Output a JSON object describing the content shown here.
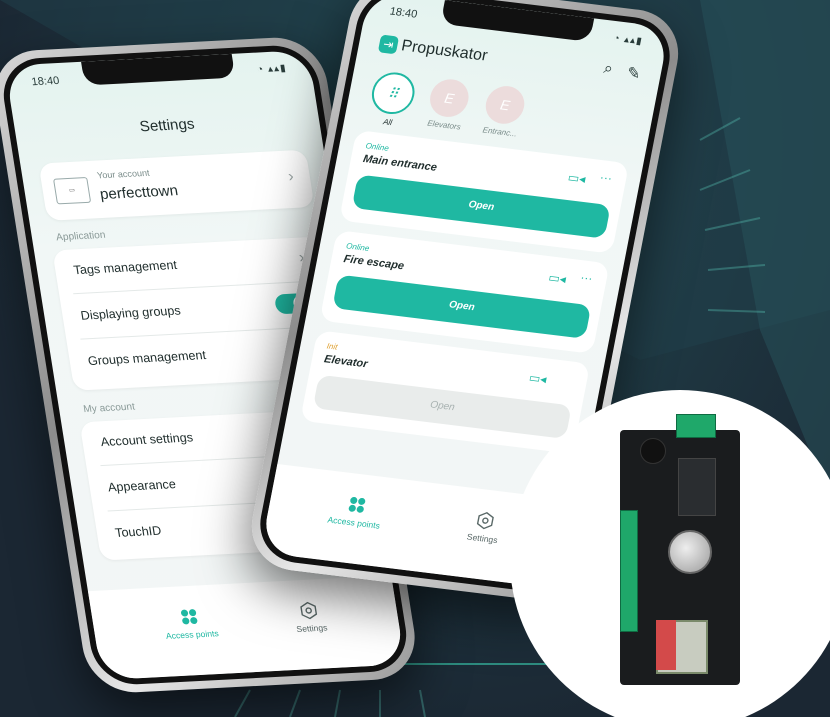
{
  "left_phone": {
    "status_time": "18:40",
    "title": "Settings",
    "account": {
      "label": "Your account",
      "name": "perfecttown"
    },
    "section_application": "Application",
    "rows_application": [
      {
        "label": "Tags management"
      },
      {
        "label": "Displaying groups"
      },
      {
        "label": "Groups management"
      }
    ],
    "section_my_account": "My account",
    "rows_account": [
      {
        "label": "Account settings"
      },
      {
        "label": "Appearance"
      },
      {
        "label": "TouchID"
      }
    ],
    "tabs": [
      {
        "label": "Access points"
      },
      {
        "label": "Settings"
      }
    ]
  },
  "right_phone": {
    "status_time": "18:40",
    "brand": "Propuskator",
    "groups": [
      {
        "label": "All",
        "glyph": "⠿"
      },
      {
        "label": "Elevators",
        "glyph": "E"
      },
      {
        "label": "Entranc...",
        "glyph": "E"
      }
    ],
    "access_points": [
      {
        "status": "Online",
        "name": "Main entrance",
        "button": "Open"
      },
      {
        "status": "Online",
        "name": "Fire escape",
        "button": "Open"
      },
      {
        "status": "Init",
        "name": "Elevator",
        "button": "Open"
      }
    ],
    "tabs": [
      {
        "label": "Access points"
      },
      {
        "label": "Settings"
      }
    ]
  },
  "colors": {
    "accent": "#1fb8a2",
    "background": "#1d2a36",
    "init_status": "#e0a233"
  }
}
